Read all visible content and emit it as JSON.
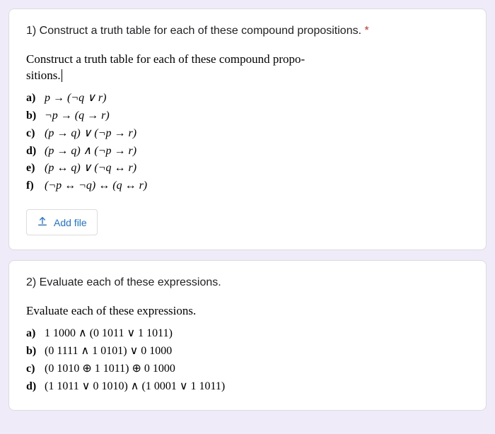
{
  "q1": {
    "title": "1) Construct a truth table for each of these compound propositions.",
    "required_mark": "*",
    "instruction_line1": "Construct a truth table for each of these compound propo-",
    "instruction_line2": "sitions.",
    "items": {
      "a_label": "a)",
      "a_expr": "p → (¬q ∨ r)",
      "b_label": "b)",
      "b_expr": "¬p → (q → r)",
      "c_label": "c)",
      "c_expr": "(p → q) ∨ (¬p → r)",
      "d_label": "d)",
      "d_expr": "(p → q) ∧ (¬p → r)",
      "e_label": "e)",
      "e_expr": "(p ↔ q) ∨ (¬q ↔ r)",
      "f_label": "f)",
      "f_expr": "(¬p ↔ ¬q) ↔ (q ↔ r)"
    },
    "add_file_label": "Add file"
  },
  "q2": {
    "title": "2) Evaluate each of these expressions.",
    "instruction": "Evaluate each of these expressions.",
    "items": {
      "a_label": "a)",
      "a_expr": "1 1000 ∧ (0 1011 ∨ 1 1011)",
      "b_label": "b)",
      "b_expr": "(0 1111 ∧ 1 0101) ∨ 0 1000",
      "c_label": "c)",
      "c_expr": "(0 1010 ⊕ 1 1011) ⊕ 0 1000",
      "d_label": "d)",
      "d_expr": "(1 1011 ∨ 0 1010) ∧ (1 0001 ∨ 1 1011)"
    }
  }
}
